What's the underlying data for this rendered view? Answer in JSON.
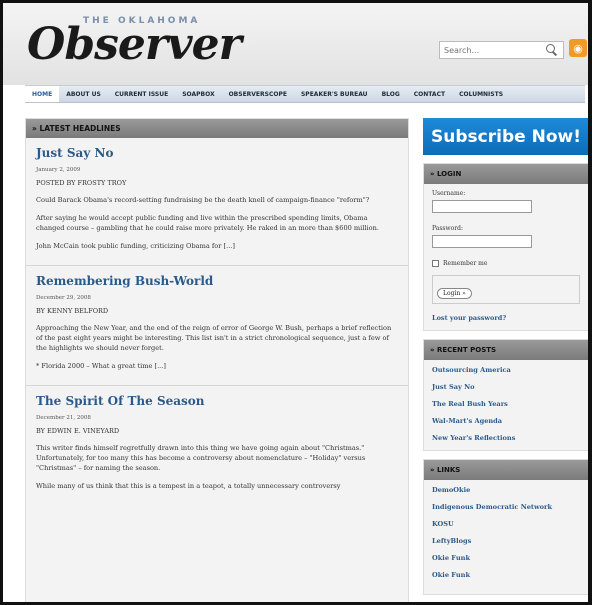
{
  "header": {
    "logo_top": "THE OKLAHOMA",
    "logo_main": "Observer",
    "search_placeholder": "Search...",
    "rss_icon": "rss-icon"
  },
  "nav": [
    "HOME",
    "ABOUT US",
    "CURRENT ISSUE",
    "SOAPBOX",
    "OBSERVERSCOPE",
    "SPEAKER'S BUREAU",
    "BLOG",
    "CONTACT",
    "COLUMNISTS"
  ],
  "main": {
    "section_title": "» LATEST HEADLINES",
    "posts": [
      {
        "title": "Just Say No",
        "date": "January 2, 2009",
        "author": "POSTED BY FROSTY TROY",
        "paragraphs": [
          "Could Barack Obama's record-setting fundraising be the death knell of campaign-finance \"reform\"?",
          "After saying he would accept public funding and live within the prescribed spending limits, Obama changed course – gambling that he could raise more privately. He raked in an more than $600 million.",
          "John McCain took public funding, criticizing Obama for [...]"
        ]
      },
      {
        "title": "Remembering Bush-World",
        "date": "December 29, 2008",
        "author": "BY KENNY BELFORD",
        "paragraphs": [
          "Approaching the New Year, and the end of the reign of error of George W. Bush, perhaps a brief reflection of the past eight years might be interesting. This list isn't in a strict chronological sequence, just a few of the highlights we should never forget.",
          "* Florida 2000 – What a great time [...]"
        ]
      },
      {
        "title": "The Spirit Of The Season",
        "date": "December 21, 2008",
        "author": "BY EDWIN E. VINEYARD",
        "paragraphs": [
          "This writer finds himself regretfully drawn into this thing we have going again about \"Christmas.\" Unfortunately, for too many this has become a controversy about nomenclature – \"Holiday\" versus \"Christmas\" – for naming the season.",
          "While many of us think that this is a tempest in a teapot, a totally unnecessary controversy"
        ]
      }
    ]
  },
  "sidebar": {
    "subscribe": "Subscribe Now!",
    "login": {
      "title": "» LOGIN",
      "username_label": "Username:",
      "password_label": "Password:",
      "remember": "Remember me",
      "button": "Login »",
      "lost": "Lost your password?"
    },
    "recent": {
      "title": "» RECENT POSTS",
      "items": [
        "Outsourcing America",
        "Just Say No",
        "The Real Bush Years",
        "Wal-Mart's Agenda",
        "New Year's Reflections"
      ]
    },
    "links": {
      "title": "» LINKS",
      "items": [
        "DemoOkie",
        "Indigenous Democratic Network",
        "KOSU",
        "LeftyBlogs",
        "Okie Funk",
        "Okie Funk"
      ]
    }
  }
}
